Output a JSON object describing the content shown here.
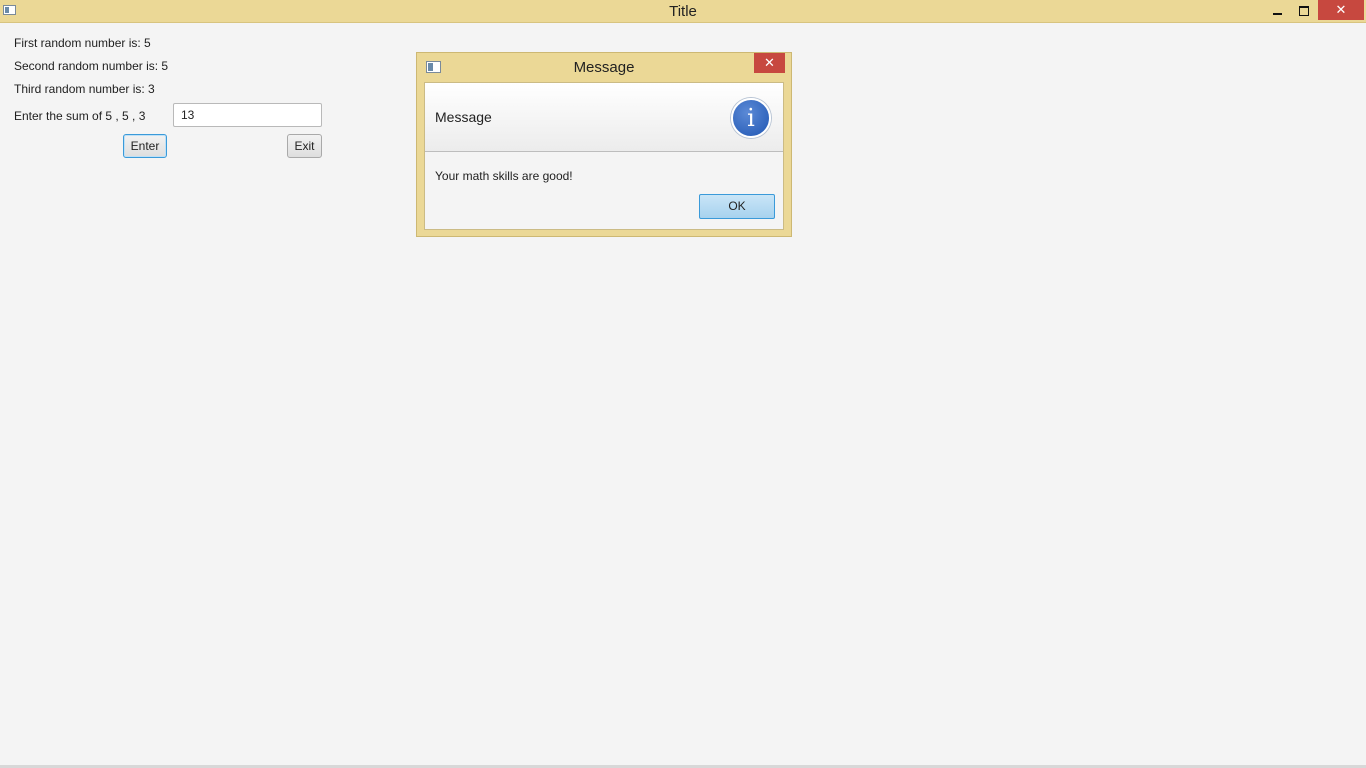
{
  "window": {
    "title": "Title",
    "controls": {
      "minimize": "minimize-icon",
      "restore": "restore-icon",
      "close": "✕"
    }
  },
  "form": {
    "first_label": "First random number is: 5",
    "second_label": "Second random number is: 5",
    "third_label": "Third random number is: 3",
    "sum_label": "Enter the sum of 5 , 5 , 3",
    "sum_value": "13",
    "enter_button": "Enter",
    "exit_button": "Exit"
  },
  "dialog": {
    "title": "Message",
    "close": "✕",
    "header": "Message",
    "info_glyph": "i",
    "content": "Your math skills are good!",
    "ok_button": "OK"
  },
  "colors": {
    "titlebar": "#ebd896",
    "close": "#c7483f",
    "focus": "#3a9ad9",
    "background": "#f4f4f4"
  }
}
